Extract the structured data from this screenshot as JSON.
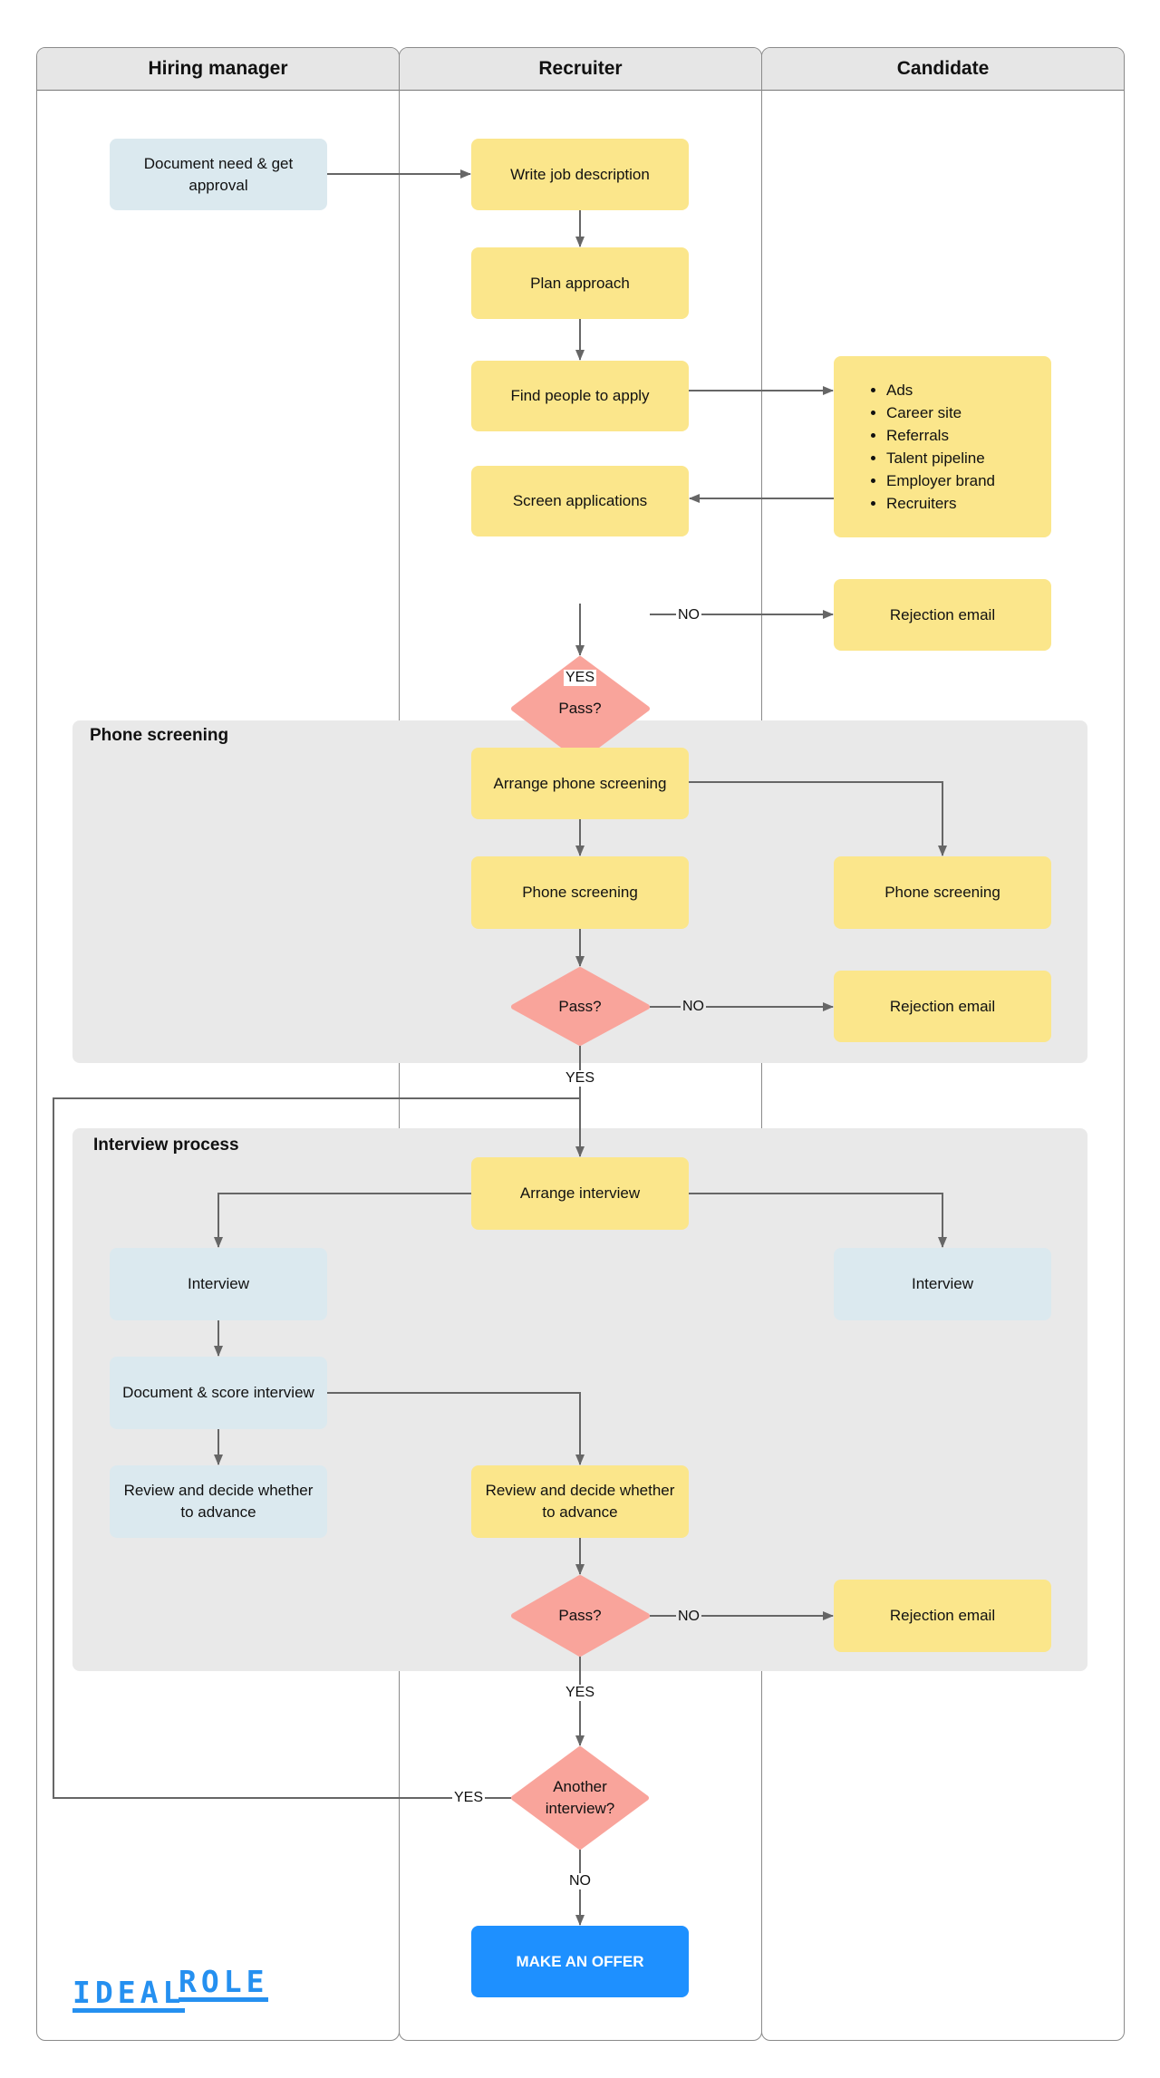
{
  "lanes": {
    "hiring_manager": "Hiring manager",
    "recruiter": "Recruiter",
    "candidate": "Candidate"
  },
  "groups": {
    "phone": "Phone screening",
    "interview": "Interview process"
  },
  "nodes": {
    "document_need": "Document need & get approval",
    "write_jd": "Write job description",
    "plan": "Plan approach",
    "find_people": "Find people to apply",
    "screen_apps": "Screen applications",
    "sources": [
      "Ads",
      "Career site",
      "Referrals",
      "Talent pipeline",
      "Employer brand",
      "Recruiters"
    ],
    "pass1": "Pass?",
    "reject1": "Rejection email",
    "arrange_phone": "Arrange phone screening",
    "phone_rec": "Phone screening",
    "phone_cand": "Phone screening",
    "pass2": "Pass?",
    "reject2": "Rejection email",
    "arrange_interview": "Arrange interview",
    "interview_hm": "Interview",
    "interview_cand": "Interview",
    "doc_score": "Document & score interview",
    "review_hm": "Review and decide whether to advance",
    "review_rec": "Review and decide whether to advance",
    "pass3": "Pass?",
    "reject3": "Rejection email",
    "another": "Another interview?",
    "offer": "MAKE AN OFFER"
  },
  "edge_labels": {
    "no1": "NO",
    "yes1": "YES",
    "no2": "NO",
    "yes2": "YES",
    "no3": "NO",
    "yes3": "YES",
    "yes_loop": "YES",
    "no_another": "NO"
  },
  "logo": {
    "word1": "IDEAL",
    "word2": "ROLE"
  },
  "colors": {
    "task_yellow": "#fbe68b",
    "task_blue": "#dbe9ef",
    "decision": "#f9a49b",
    "offer": "#1e90ff",
    "group_bg": "#e9e9e9",
    "connector": "#666666",
    "brand": "#2590f0"
  }
}
